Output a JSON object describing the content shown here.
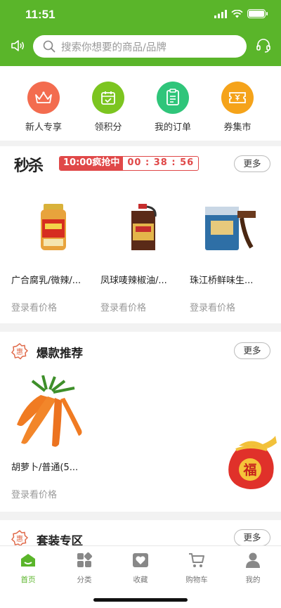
{
  "status_bar": {
    "time": "11:51"
  },
  "search": {
    "placeholder": "搜索你想要的商品/品牌"
  },
  "quick_nav": [
    {
      "label": "新人专享",
      "color": "#f36c4f",
      "icon": "crown-icon"
    },
    {
      "label": "领积分",
      "color": "#7cc520",
      "icon": "calendar-check-icon"
    },
    {
      "label": "我的订单",
      "color": "#2fc57a",
      "icon": "clipboard-icon"
    },
    {
      "label": "券集市",
      "color": "#f5a31a",
      "icon": "ticket-icon"
    }
  ],
  "seckill": {
    "logo": "秒杀",
    "countdown_label": "10:00疯抢中",
    "countdown_time": "00 : 38 : 56",
    "more": "更多",
    "products": [
      {
        "name": "广合腐乳/微辣/...",
        "price": "登录看价格",
        "image": "fermented-tofu-jar"
      },
      {
        "name": "凤球唛辣椒油/...",
        "price": "登录看价格",
        "image": "chili-oil-bottle"
      },
      {
        "name": "珠江桥鲜味生...",
        "price": "登录看价格",
        "image": "soy-sauce-tin"
      }
    ]
  },
  "hot": {
    "title": "爆款推荐",
    "more": "更多",
    "products": [
      {
        "name": "胡萝卜/普通(5...",
        "price": "登录看价格",
        "image": "carrots"
      }
    ]
  },
  "bundle": {
    "title": "套装专区",
    "more": "更多"
  },
  "float_badge": {
    "char": "福"
  },
  "tabbar": [
    {
      "label": "首页",
      "icon": "home-icon",
      "active": true
    },
    {
      "label": "分类",
      "icon": "category-icon",
      "active": false
    },
    {
      "label": "收藏",
      "icon": "heart-icon",
      "active": false
    },
    {
      "label": "购物车",
      "icon": "cart-icon",
      "active": false
    },
    {
      "label": "我的",
      "icon": "user-icon",
      "active": false
    }
  ],
  "colors": {
    "primary": "#5ab52a",
    "countdown": "#e04848"
  }
}
